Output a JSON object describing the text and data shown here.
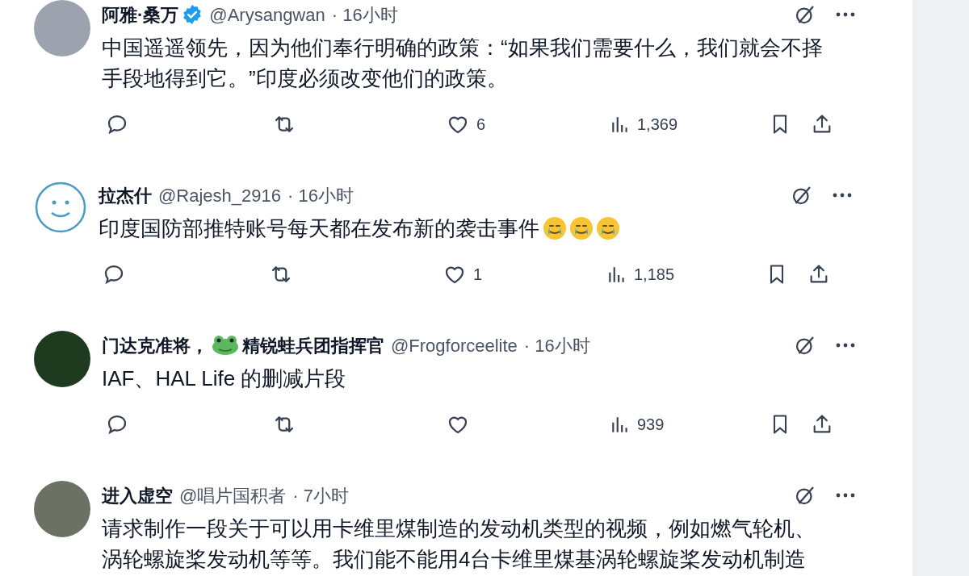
{
  "posts": [
    {
      "avatar": {
        "kind": "photo"
      },
      "name": "阿雅·桑万",
      "verified": true,
      "handle": "@Arysangwan",
      "time": "· 16小时",
      "body": "中国遥遥领先，因为他们奉行明确的政策：“如果我们需要什么，我们就会不择手段地得到它。”印度必须改变他们的政策。",
      "actions": {
        "likes": "6",
        "views": "1,369"
      }
    },
    {
      "avatar": {
        "kind": "smiley"
      },
      "name": "拉杰什",
      "verified": false,
      "handle": "@Rajesh_2916",
      "time": "· 16小时",
      "body": "印度国防部推特账号每天都在发布新的袭击事件",
      "body_emojis": [
        {
          "kind": "teary-smile"
        },
        {
          "kind": "teary-smile"
        },
        {
          "kind": "teary-smile"
        }
      ],
      "actions": {
        "likes": "1",
        "views": "1,185"
      }
    },
    {
      "avatar": {
        "kind": "photo"
      },
      "name": "门达克准将，",
      "name_frog": true,
      "name_suffix": "精锐蛙兵团指挥官",
      "verified": false,
      "handle": "@Frogforceelite",
      "time": "· 16小时",
      "body": "IAF、HAL Life 的删减片段",
      "actions": {
        "views": "939"
      }
    },
    {
      "avatar": {
        "kind": "photo"
      },
      "name": "进入虚空",
      "verified": false,
      "handle": "@唱片国积者",
      "time": "· 7小时",
      "body": "请求制作一段关于可以用卡维里煤制造的发动机类型的视频，例如燃气轮机、涡轮螺旋桨发动机等等。我们能不能用4台卡维里煤基涡轮螺旋桨发动机制造"
    }
  ]
}
